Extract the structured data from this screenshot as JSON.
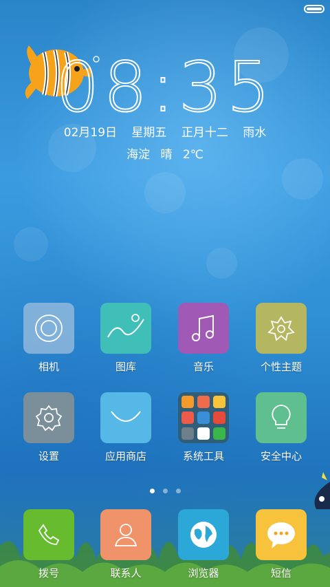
{
  "status_bar": {
    "battery_level": 1.0
  },
  "clock": {
    "hour": "08",
    "minute": "35",
    "separator": ":"
  },
  "date": {
    "day": "02月19日",
    "weekday": "星期五",
    "lunar_date": "正月十二",
    "solar_term": "雨水"
  },
  "weather": {
    "location": "海淀",
    "condition": "晴",
    "temperature": "2℃"
  },
  "apps": [
    {
      "label": "相机",
      "icon": "camera-icon",
      "color": "#8fb8dd"
    },
    {
      "label": "图库",
      "icon": "gallery-icon",
      "color": "#3fbfb7"
    },
    {
      "label": "音乐",
      "icon": "music-icon",
      "color": "#a05ab5"
    },
    {
      "label": "个性主题",
      "icon": "theme-flower-icon",
      "color": "#b4b660"
    },
    {
      "label": "设置",
      "icon": "gear-icon",
      "color": "#7b8f9a"
    },
    {
      "label": "应用商店",
      "icon": "store-smile-icon",
      "color": "#56b8e6"
    },
    {
      "label": "系统工具",
      "icon": "folder-icon",
      "color": "#2f5e7b"
    },
    {
      "label": "安全中心",
      "icon": "security-lightbulb-icon",
      "color": "#5fbf8f"
    }
  ],
  "pages": {
    "count": 3,
    "active_index": 0
  },
  "dock": [
    {
      "label": "拨号",
      "icon": "phone-icon",
      "color": "#66bb2f"
    },
    {
      "label": "联系人",
      "icon": "contacts-icon",
      "color": "#f0926a"
    },
    {
      "label": "浏览器",
      "icon": "globe-icon",
      "color": "#2ba8d8"
    },
    {
      "label": "短信",
      "icon": "message-bubble-icon",
      "color": "#f7c23c"
    }
  ]
}
